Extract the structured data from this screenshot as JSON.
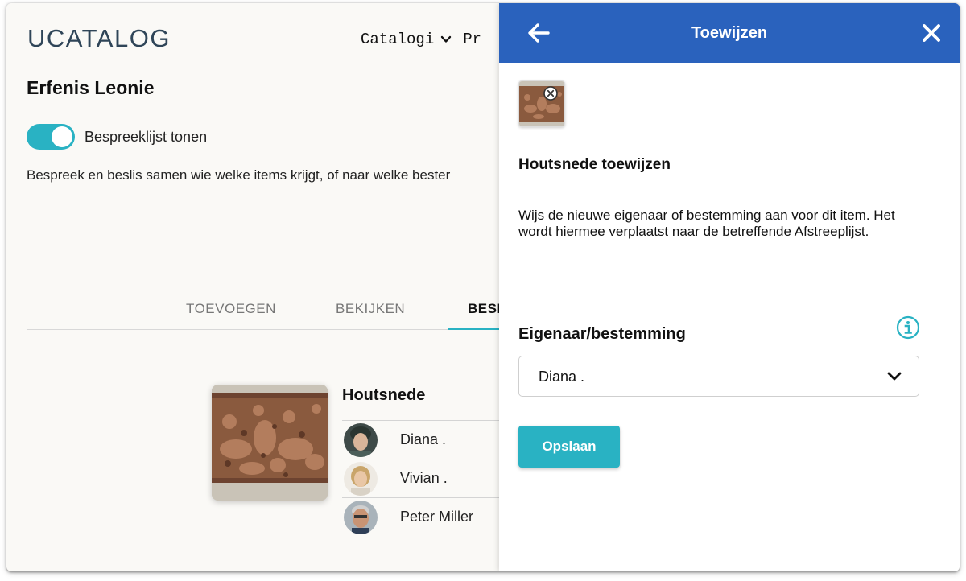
{
  "app": {
    "logo": "UCATALOG"
  },
  "nav": {
    "catalogi": "Catalogi",
    "partial": "Pr"
  },
  "page": {
    "title": "Erfenis Leonie",
    "toggle_label": "Bespreeklijst tonen",
    "toggle_on": true,
    "description": "Bespreek en beslis samen wie welke items krijgt, of naar welke bester"
  },
  "tabs": [
    {
      "label": "TOEVOEGEN"
    },
    {
      "label": "BEKIJKEN"
    },
    {
      "label": "BESI"
    }
  ],
  "item": {
    "name": "Houtsnede",
    "people": [
      {
        "name": "Diana ."
      },
      {
        "name": "Vivian ."
      },
      {
        "name": "Peter Miller"
      }
    ]
  },
  "drawer": {
    "title": "Toewijzen",
    "heading": "Houtsnede toewijzen",
    "text": "Wijs de nieuwe eigenaar of bestemming aan voor dit item. Het wordt hiermee verplaatst naar de betreffende Afstreeplijst.",
    "field_label": "Eigenaar/bestemming",
    "selected_owner": "Diana .",
    "save_label": "Opslaan"
  },
  "colors": {
    "header_blue": "#2a62bd",
    "accent_teal": "#29b2c3",
    "logo_navy": "#2f4558"
  },
  "icons": [
    "chevron-down-icon",
    "back-arrow-icon",
    "close-icon",
    "remove-icon",
    "info-icon"
  ]
}
